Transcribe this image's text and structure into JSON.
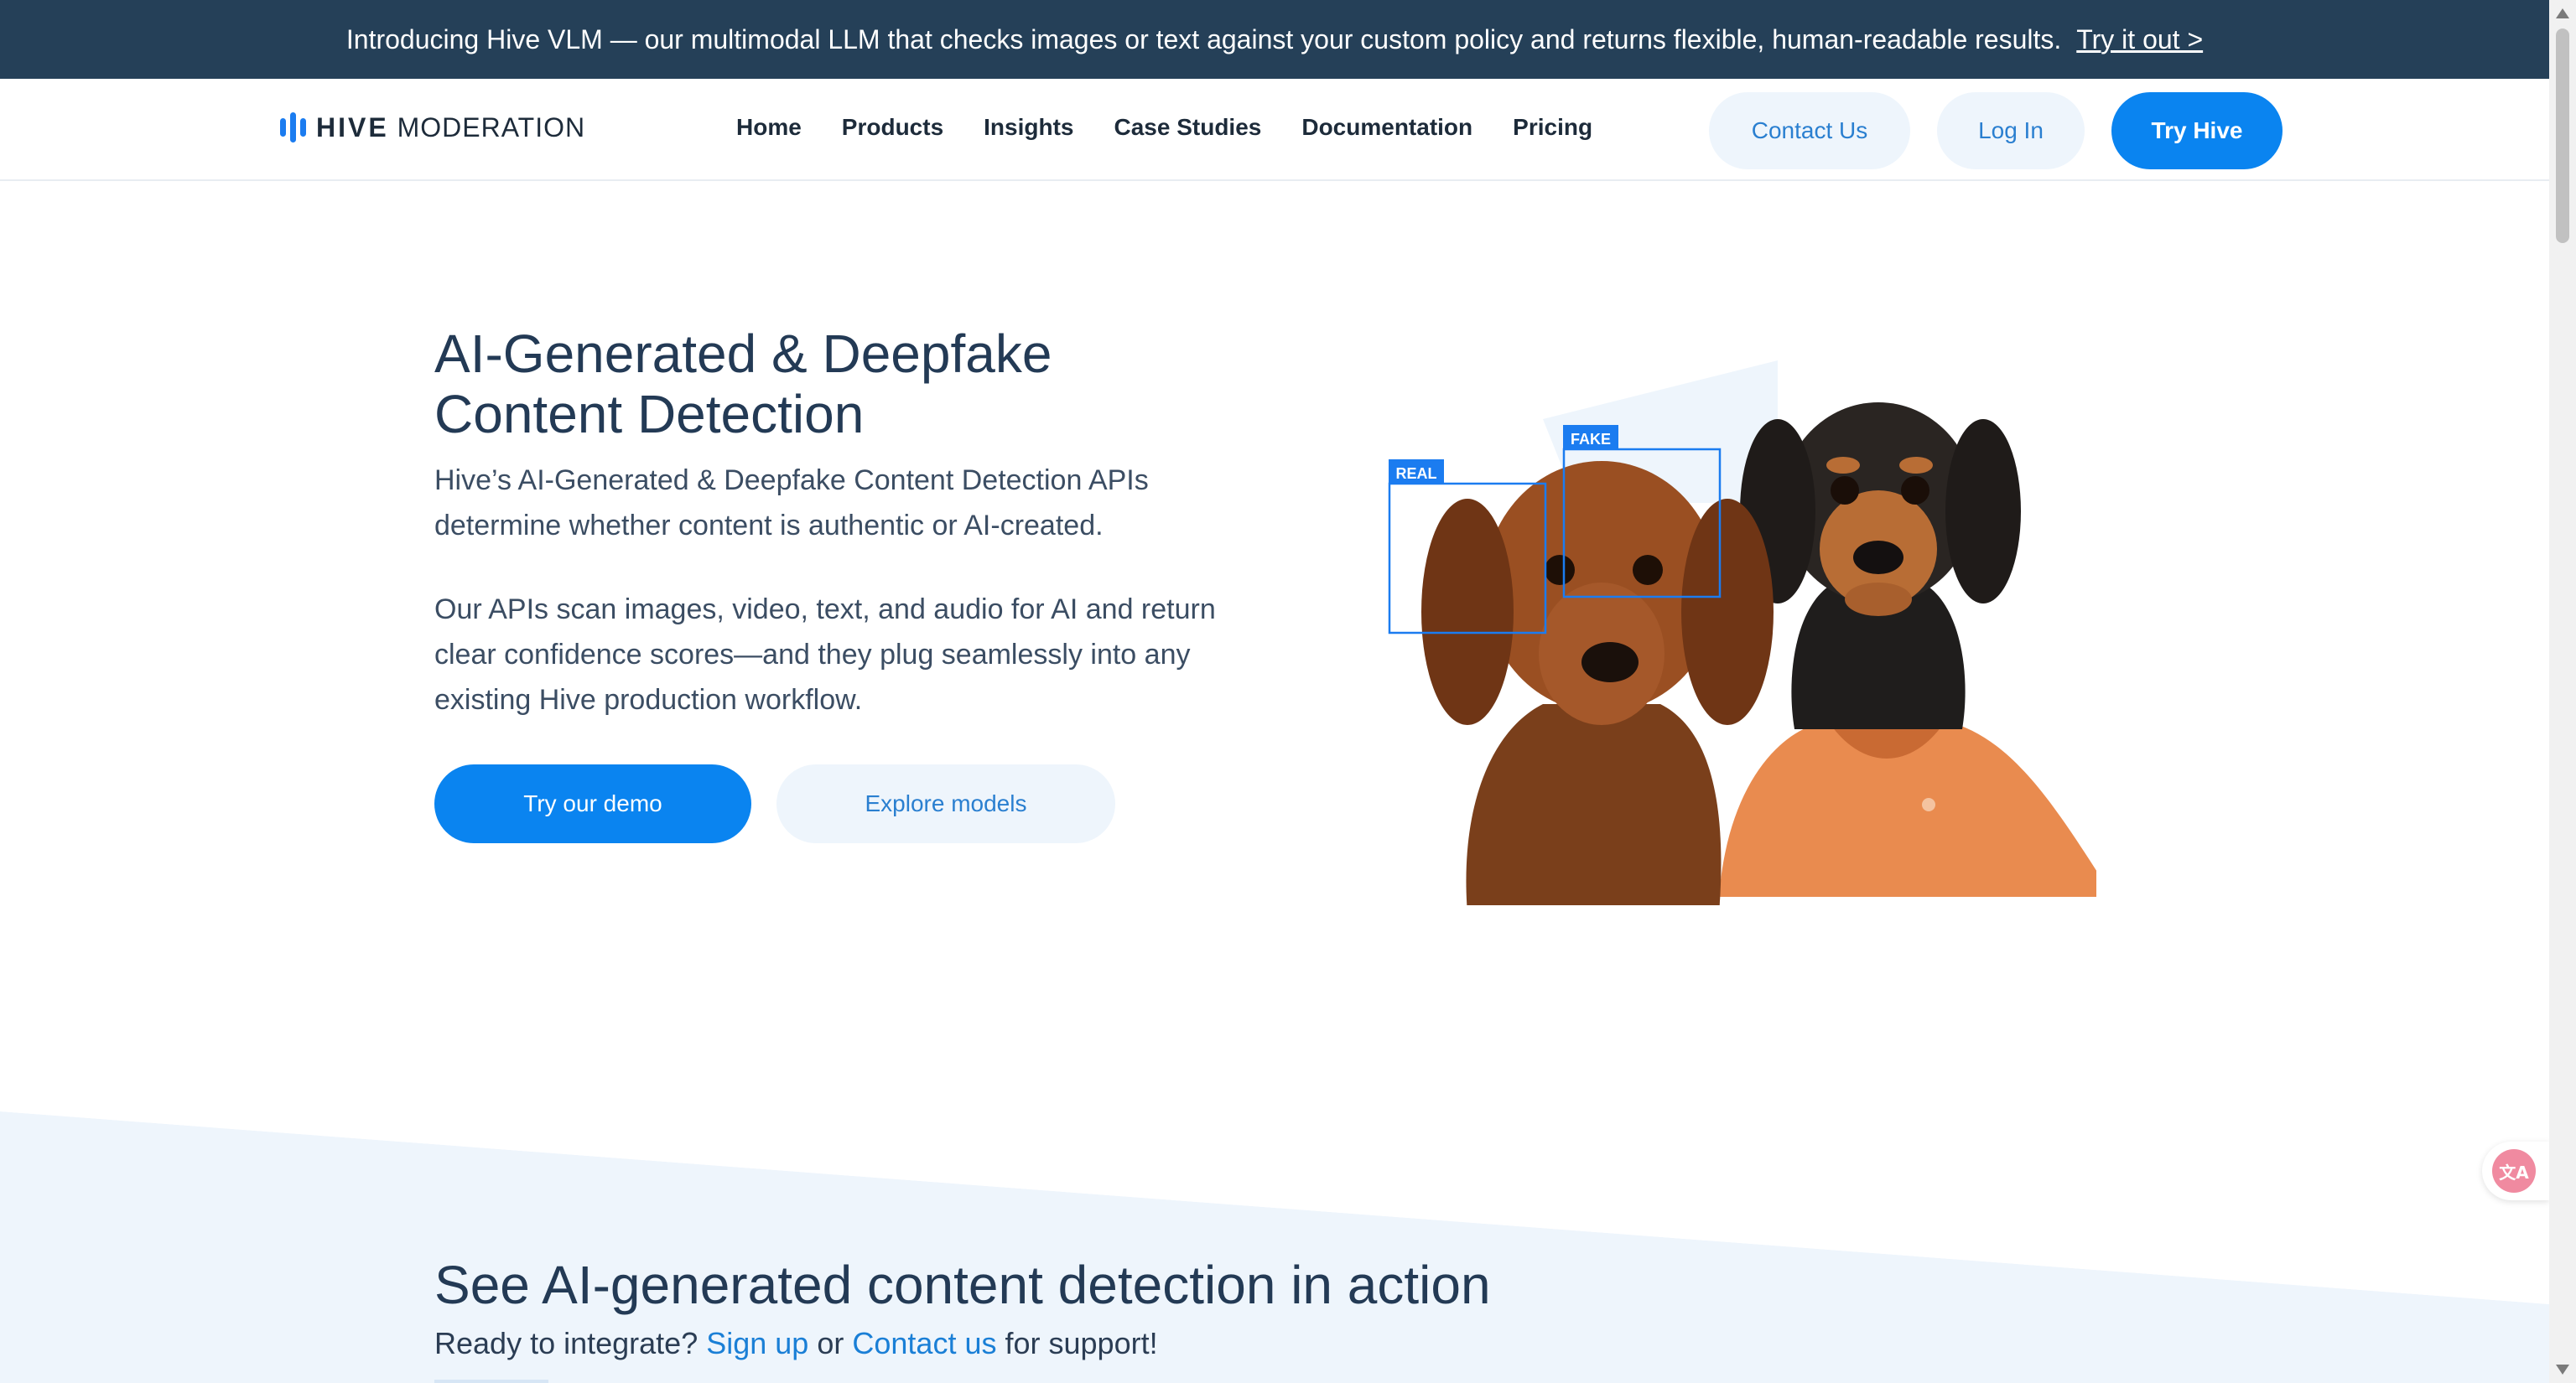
{
  "announcement": {
    "text": "Introducing Hive VLM — our multimodal LLM that checks images or text against your custom policy and returns flexible, human-readable results.",
    "link": "Try it out >"
  },
  "header": {
    "logo_bold": "HIVE",
    "logo_light": "MODERATION",
    "nav": [
      "Home",
      "Products",
      "Insights",
      "Case Studies",
      "Documentation",
      "Pricing"
    ],
    "contact": "Contact Us",
    "login": "Log In",
    "try_hive": "Try Hive"
  },
  "hero": {
    "title_line1": "AI-Generated & Deepfake",
    "title_line2": "Content Detection",
    "para1": "Hive’s AI-Generated & Deepfake Content Detection APIs determine whether content is authentic or AI-created.",
    "para2": "Our APIs scan images, video, text, and audio for AI and return clear confidence scores—and they plug seamlessly into any existing Hive production workflow.",
    "demo_button": "Try our demo",
    "explore_button": "Explore models",
    "label_real": "REAL",
    "label_fake": "FAKE"
  },
  "section": {
    "title": "See AI-generated content detection in action",
    "sub_prefix": "Ready to integrate?",
    "sign_up": "Sign up",
    "or": "or",
    "contact_us": "Contact us",
    "sub_suffix": "for support!"
  },
  "colors": {
    "announce_bg": "#254058",
    "accent": "#0a84f0",
    "pale_button": "#eef5fc",
    "detection_box": "#1b7cf0",
    "section_bg": "#eef5fc"
  },
  "icons": {
    "logo": "hive-logo-icon",
    "translate": "translate-icon"
  }
}
